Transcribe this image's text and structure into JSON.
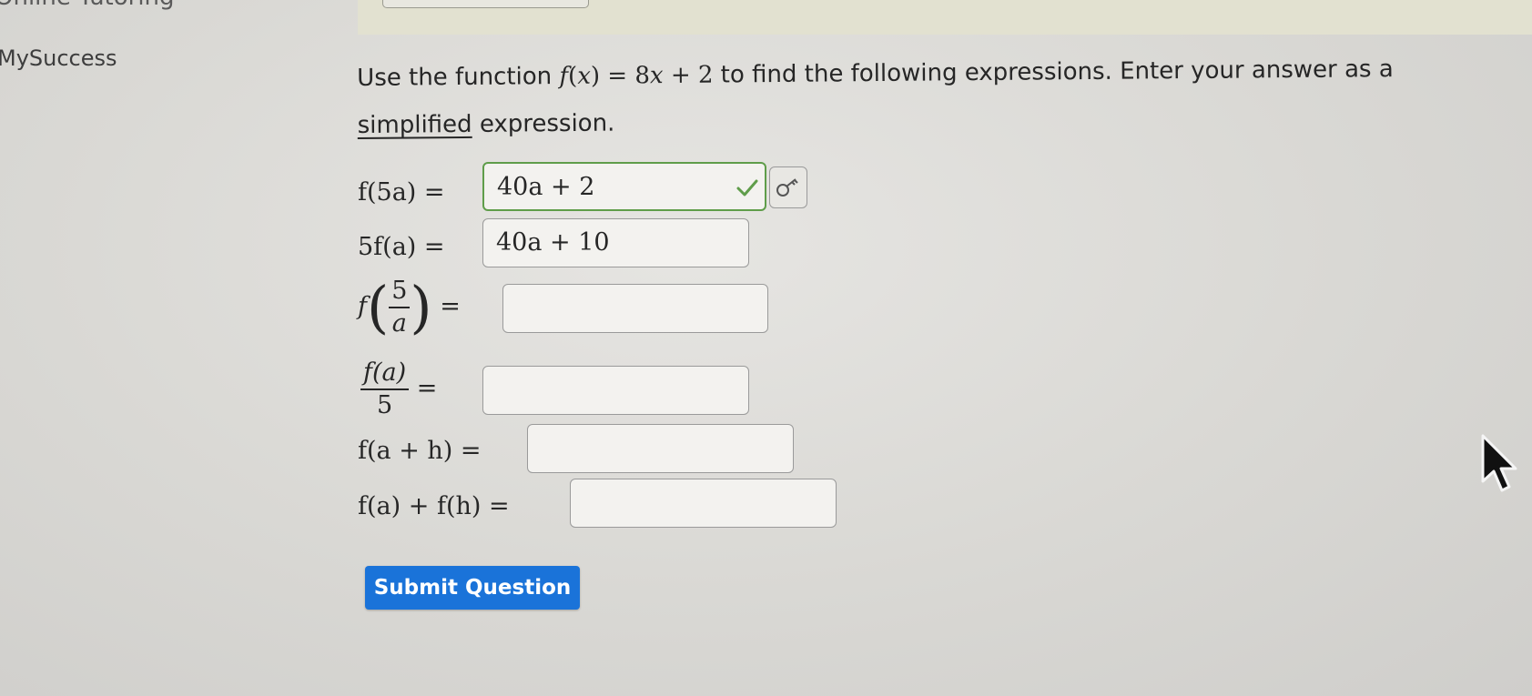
{
  "nav": {
    "top_text": "Online Tutoring",
    "sidebar_link": "MySuccess"
  },
  "question": {
    "prefix": "Use the function ",
    "fn_f": "f",
    "fn_var": "x",
    "fn_rhs_num": "8",
    "fn_rhs_var": "x",
    "fn_rhs_const": "2",
    "suffix": " to find the following expressions. Enter your answer as a ",
    "underlined_word": "simplified",
    "ending": " expression."
  },
  "rows": [
    {
      "label": "f(5a) =",
      "value": "40a + 2",
      "status": "correct"
    },
    {
      "label": "5f(a) =",
      "value": "40a + 10",
      "status": "entered"
    },
    {
      "label_func": "f",
      "label_num": "5",
      "label_den": "a",
      "label_eq": "=",
      "value": "",
      "status": "empty"
    },
    {
      "label_num": "f(a)",
      "label_den": "5",
      "label_eq": "=",
      "value": "",
      "status": "empty"
    },
    {
      "label": "f(a + h) =",
      "value": "",
      "status": "empty"
    },
    {
      "label": "f(a) + f(h) =",
      "value": "",
      "status": "empty"
    }
  ],
  "submit": {
    "label": "Submit Question"
  },
  "colors": {
    "accent": "#1a73d9",
    "correct": "#5f9d4a",
    "background": "#dcdbd7"
  },
  "icons": {
    "check": "check-icon",
    "key": "key-icon",
    "cursor": "mouse-cursor-icon"
  }
}
